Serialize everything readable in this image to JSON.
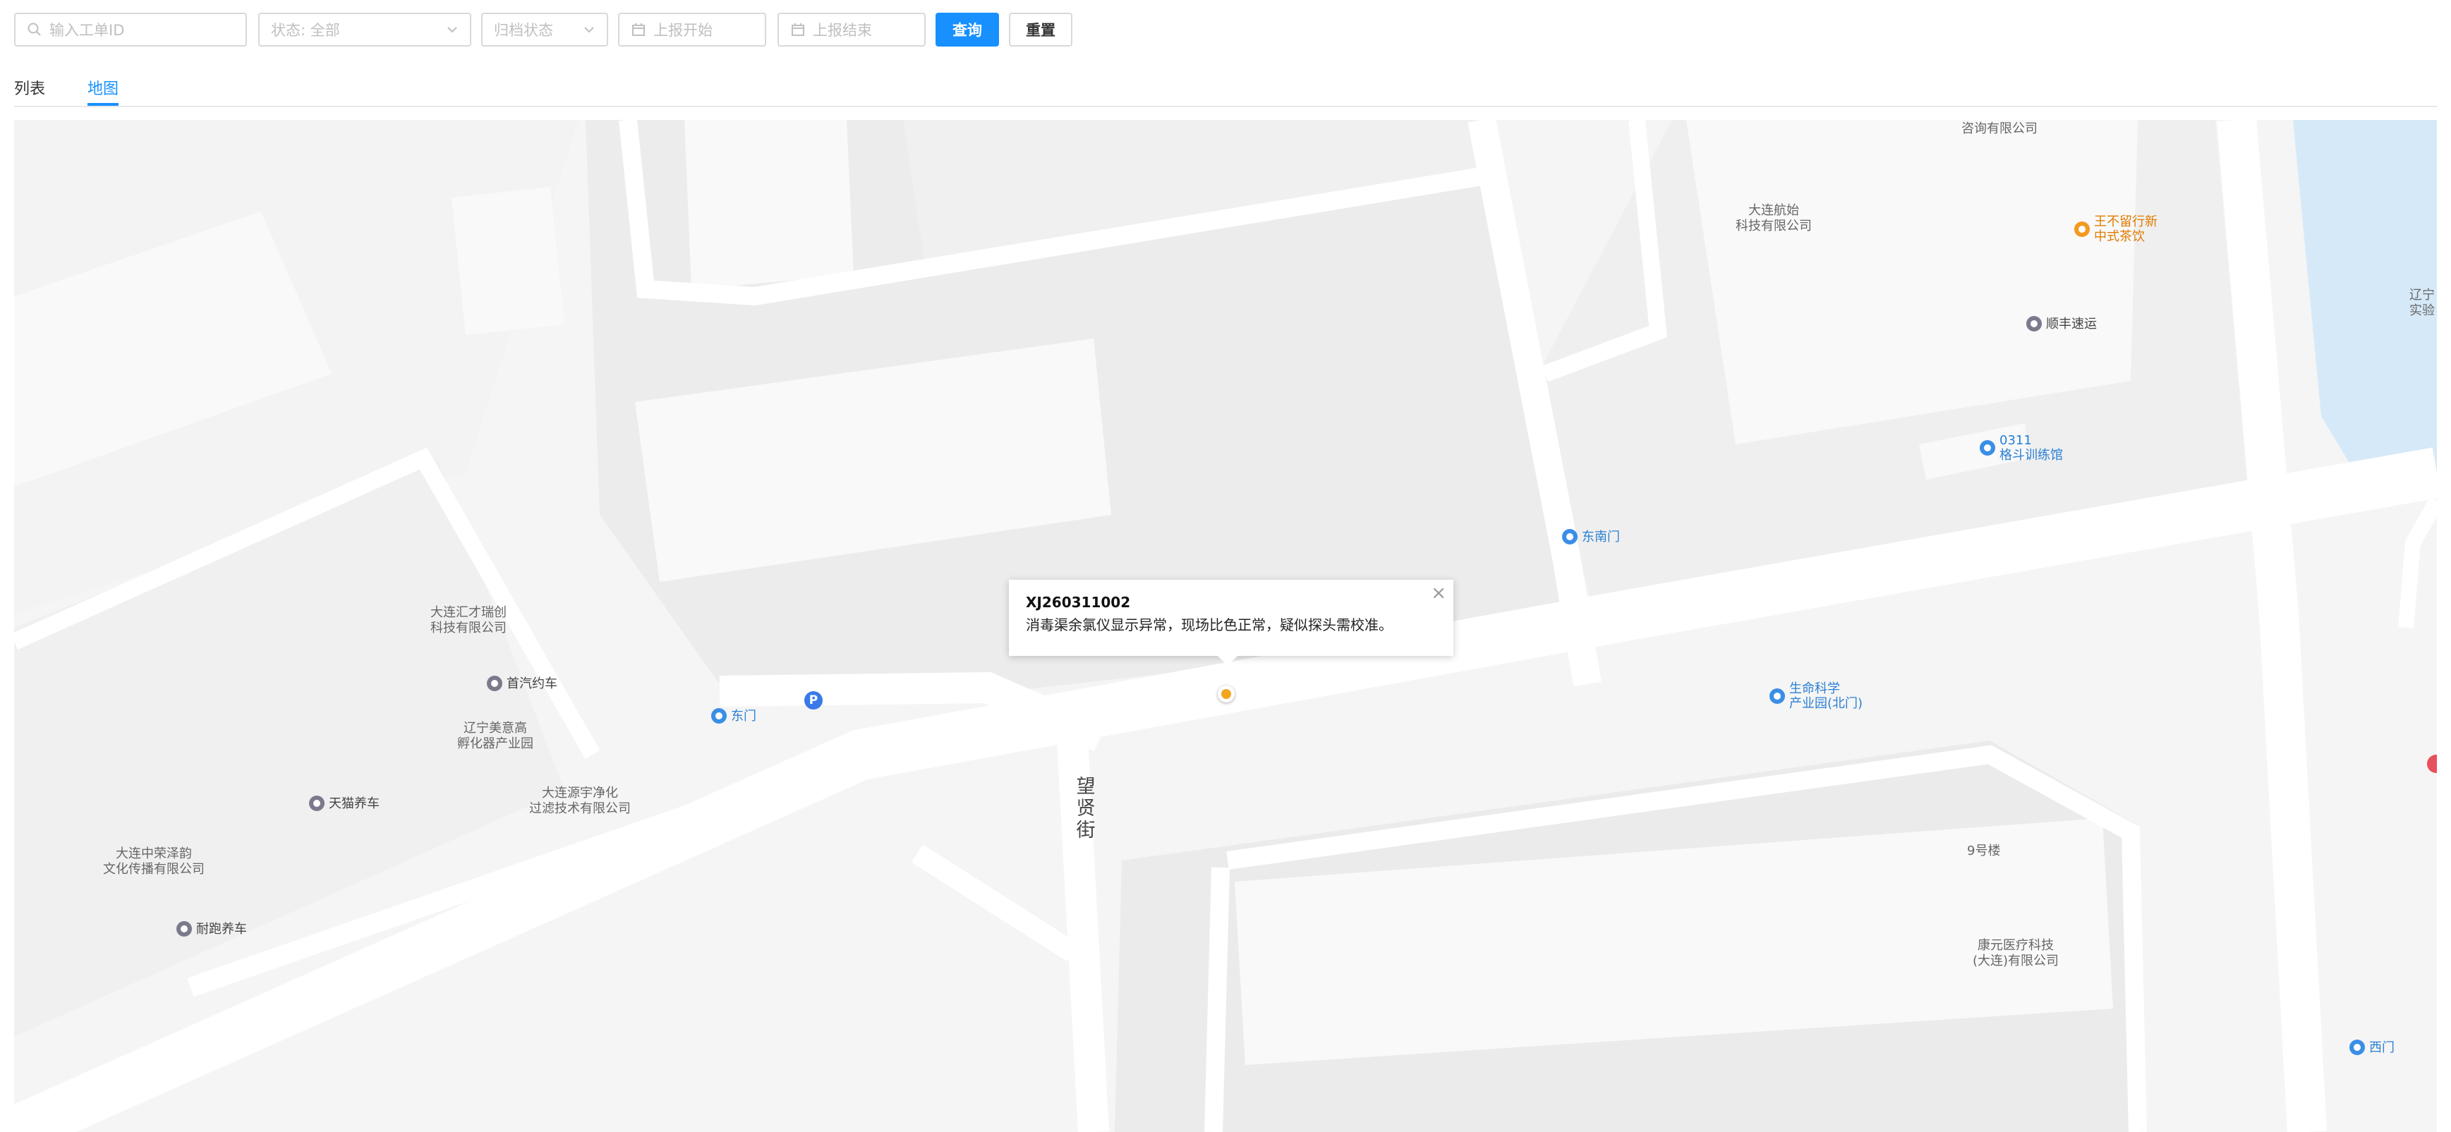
{
  "filters": {
    "ticket_id_placeholder": "输入工单ID",
    "status_label": "状态: 全部",
    "archive_placeholder": "归档状态",
    "start_placeholder": "上报开始",
    "end_placeholder": "上报结束",
    "query_label": "查询",
    "reset_label": "重置"
  },
  "tabs": [
    {
      "label": "列表",
      "active": false
    },
    {
      "label": "地图",
      "active": true
    }
  ],
  "map": {
    "popup": {
      "title": "XJ260311002",
      "body": "消毒渠余氯仪显示异常，现场比色正常，疑似探头需校准。",
      "close": "×"
    },
    "parking_glyph": "P",
    "street_name": "望\n贤\n街",
    "labels": {
      "consulting_co": "咨询有限公司",
      "dalian_hangshi": "大连航始\n科技有限公司",
      "wang_bu_liu": "王不留行新\n中式茶饮",
      "shunfeng": "顺丰速运",
      "fight_gym": "0311\n格斗训练馆",
      "dongnanmen": "东南门",
      "liaoning_edge": "辽宁\n实验",
      "huicai": "大连汇才瑞创\n科技有限公司",
      "shouqi": "首汽约车",
      "dongmen": "东门",
      "meiyi": "辽宁美意高\n孵化器产业园",
      "yuanyu": "大连源宇净化\n过滤技术有限公司",
      "tianmao": "天猫养车",
      "zhongrong": "大连中荣泽韵\n文化传播有限公司",
      "naipao": "耐跑养车",
      "life_sci": "生命科学\n产业园(北门)",
      "bldg9": "9号楼",
      "kangyuan": "康元医疗科技\n(大连)有限公司",
      "ximen": "西门"
    },
    "colors": {
      "poi_blue": "#3a8ee6",
      "poi_gray": "#7a7a8c",
      "poi_orange": "#f29a1f",
      "water": "#d6e9f8",
      "road": "#ffffff",
      "block": "#eeeeee",
      "building": "#f9f9f9"
    }
  }
}
